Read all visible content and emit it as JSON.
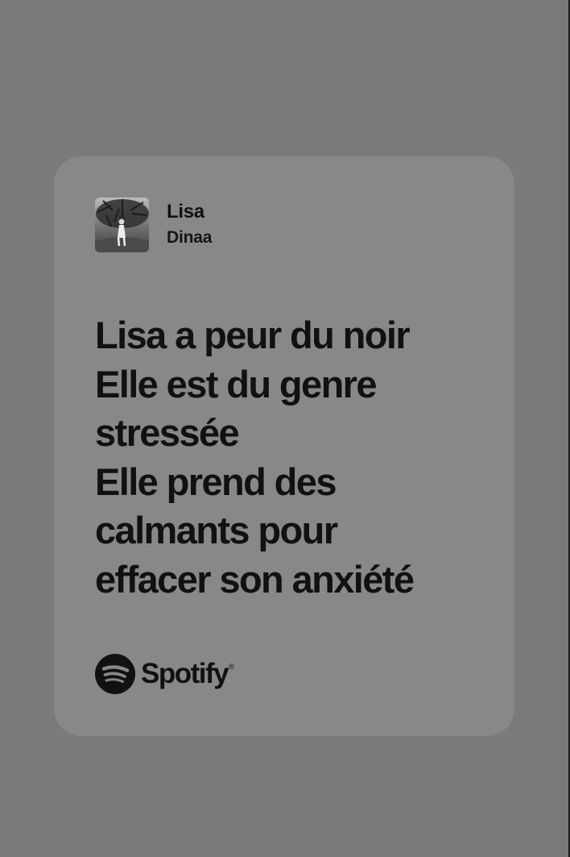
{
  "track": {
    "title": "Lisa",
    "artist": "Dinaa",
    "album_art": "black-and-white-photo-person-under-tree"
  },
  "lyrics": [
    "Lisa a peur du noir",
    "Elle est du genre",
    "stressée",
    "Elle prend des",
    "calmants pour",
    "effacer son anxiété"
  ],
  "brand": {
    "name": "Spotify",
    "trademark": "®",
    "icon": "spotify-logo-icon"
  },
  "colors": {
    "background": "#7a7a7a",
    "card": "#888888",
    "text": "#111111"
  }
}
